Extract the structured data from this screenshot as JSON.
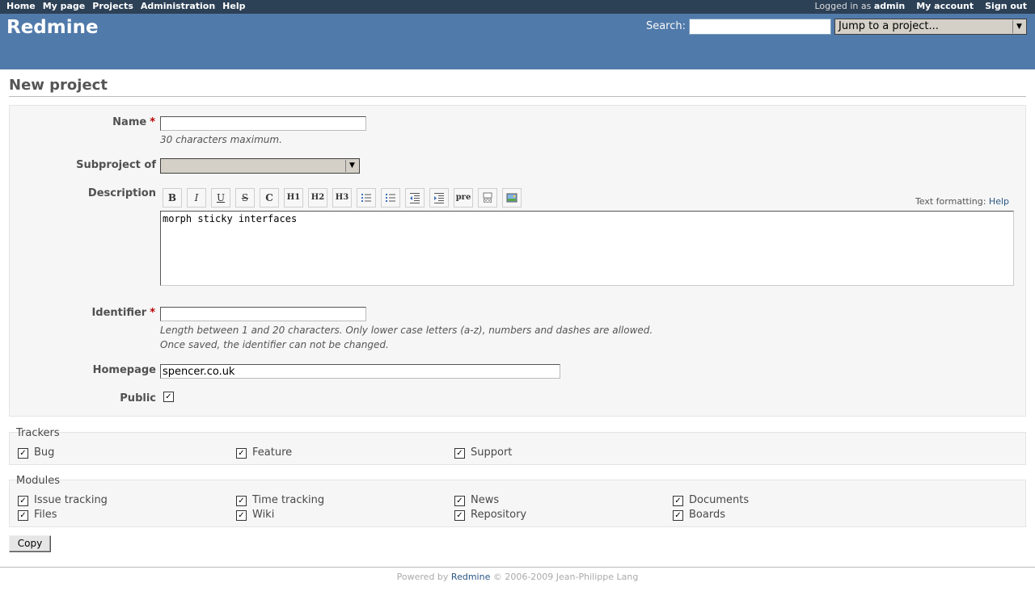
{
  "top_menu": {
    "items": [
      "Home",
      "My page",
      "Projects",
      "Administration",
      "Help"
    ],
    "logged_in_prefix": "Logged in as",
    "user": "admin",
    "my_account": "My account",
    "sign_out": "Sign out"
  },
  "header": {
    "title": "Redmine",
    "search_label": "Search:",
    "search_value": "",
    "jump_label": "Jump to a project..."
  },
  "page": {
    "title": "New project"
  },
  "form": {
    "name_label": "Name",
    "required_mark": "*",
    "name_value": "",
    "name_hint": "30 characters maximum.",
    "subproject_label": "Subproject of",
    "subproject_value": "",
    "description_label": "Description",
    "toolbar": [
      "B",
      "I",
      "U",
      "S",
      "C",
      "H1",
      "H2",
      "H3",
      "ul",
      "ol",
      "indent-less",
      "indent-more",
      "pre",
      "link",
      "image"
    ],
    "toolbar_pre": "pre",
    "text_formatting_label": "Text formatting:",
    "text_formatting_help": "Help",
    "description_value": "morph sticky interfaces",
    "identifier_label": "Identifier",
    "identifier_value": "",
    "identifier_hint_1": "Length between 1 and 20 characters. Only lower case letters (a-z), numbers and dashes are allowed.",
    "identifier_hint_2": "Once saved, the identifier can not be changed.",
    "homepage_label": "Homepage",
    "homepage_value": "spencer.co.uk",
    "public_label": "Public",
    "public_checked": true
  },
  "trackers": {
    "legend": "Trackers",
    "items": [
      {
        "label": "Bug",
        "checked": true
      },
      {
        "label": "Feature",
        "checked": true
      },
      {
        "label": "Support",
        "checked": true
      }
    ]
  },
  "modules": {
    "legend": "Modules",
    "items": [
      {
        "label": "Issue tracking",
        "checked": true
      },
      {
        "label": "Time tracking",
        "checked": true
      },
      {
        "label": "News",
        "checked": true
      },
      {
        "label": "Documents",
        "checked": true
      },
      {
        "label": "Files",
        "checked": true
      },
      {
        "label": "Wiki",
        "checked": true
      },
      {
        "label": "Repository",
        "checked": true
      },
      {
        "label": "Boards",
        "checked": true
      }
    ]
  },
  "submit_label": "Copy",
  "footer": {
    "prefix": "Powered by",
    "link": "Redmine",
    "suffix": "© 2006-2009 Jean-Philippe Lang"
  },
  "colors": {
    "top_menu_bg": "#2c4056",
    "header_bg": "#507aaa",
    "required": "#bb0000",
    "link": "#2a5685"
  }
}
